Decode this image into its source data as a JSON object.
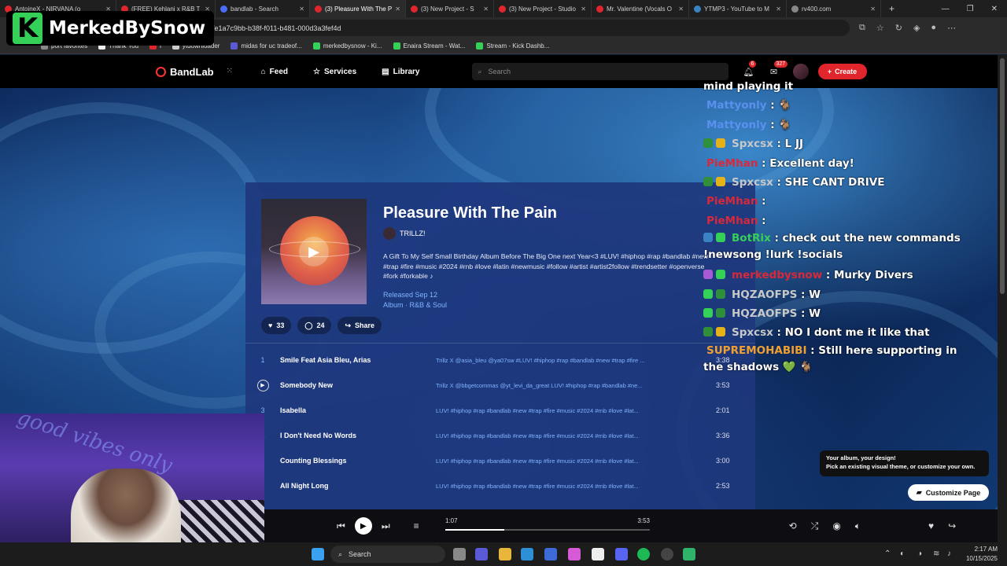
{
  "browser": {
    "tabs": [
      {
        "title": "AntoineX - NIRVANA (o",
        "color": "#e0262c"
      },
      {
        "title": "(FREE) Kehlani x R&B T",
        "color": "#e0262c"
      },
      {
        "title": "bandlab - Search",
        "color": "#4a6cf7"
      },
      {
        "title": "(3) Pleasure With The P",
        "color": "#e0262c"
      },
      {
        "title": "(3) New Project - S",
        "color": "#e0262c"
      },
      {
        "title": "(3) New Project - Studio",
        "color": "#e0262c"
      },
      {
        "title": "Mr. Valentine (Vocals O",
        "color": "#e0262c"
      },
      {
        "title": "YTMP3 - YouTube to M",
        "color": "#3b82c4"
      },
      {
        "title": "rv400.com",
        "color": "#888888"
      }
    ],
    "url": "/e1a7c9bb-b38f-f011-b481-000d3a3fef4d",
    "bookmarks": [
      "port favorites",
      "Thank You",
      "i",
      "ytdownloader",
      "midas for uc tradeof...",
      "merkedbysnow - Ki...",
      "Enaira Stream - Wat...",
      "Stream - Kick Dashb..."
    ]
  },
  "overlay_logo": {
    "letter": "K",
    "name": "MerkedBySnow",
    "accent": "#34d058"
  },
  "bandlab": {
    "brand": "BandLab",
    "nav": {
      "feed": "Feed",
      "services": "Services",
      "library": "Library"
    },
    "search_placeholder": "Search",
    "notif_badge": "6",
    "msg_badge": "327",
    "create_label": "Create"
  },
  "album": {
    "title": "Pleasure With The Pain",
    "artist": "TRILLZ!",
    "description": "A Gift To My Self Small Birthday Album Before The Big One next Year<3 #LUV! #hiphop #rap #bandlab #new #trap #fire #music #2024 #rnb #love #latin #newmusic #follow #artist #artist2follow #trendsetter #openverse #fork #forkable ♪",
    "released": "Released Sep 12",
    "type_genre": "Album · R&B & Soul",
    "likes": "33",
    "comments": "24",
    "share_label": "Share"
  },
  "tracks": [
    {
      "num": "1",
      "name": "Smile Feat Asia Bleu, Arias",
      "tags": "Trillz X @asia_bleu @ya07sw #LUV! #hiphop #rap #bandlab #new #trap #fire ...",
      "dur": "3:38"
    },
    {
      "num": "",
      "name": "Somebody New",
      "tags": "Trillz X @bbgetcommas @yt_levi_da_great LUV! #hiphop #rap #bandlab #ne...",
      "dur": "3:53"
    },
    {
      "num": "3",
      "name": "Isabella",
      "tags": "LUV! #hiphop #rap #bandlab #new #trap #fire #music #2024 #rnb #love #lat...",
      "dur": "2:01"
    },
    {
      "num": "4",
      "name": "I Don't Need No Words",
      "tags": "LUV! #hiphop #rap #bandlab #new #trap #fire #music #2024 #rnb #love #lat...",
      "dur": "3:36"
    },
    {
      "num": "5",
      "name": "Counting Blessings",
      "tags": "LUV! #hiphop #rap #bandlab #new #trap #fire #music #2024 #rnb #love #lat...",
      "dur": "3:00"
    },
    {
      "num": "6",
      "name": "All Night Long",
      "tags": "LUV! #hiphop #rap #bandlab #new #trap #fire #music #2024 #rnb #love #lat...",
      "dur": "2:53"
    }
  ],
  "chat": [
    {
      "user": "",
      "text": "mind playing it",
      "color": "#ffffff",
      "icons": []
    },
    {
      "user": "Mattyonly",
      "text": ": 🐐",
      "color": "#5b8ff0",
      "icons": []
    },
    {
      "user": "Mattyonly",
      "text": ": 🐐",
      "color": "#5b8ff0",
      "icons": []
    },
    {
      "user": "Spxcsx",
      "text": ": L JJ",
      "color": "#c8c8c8",
      "icons": [
        "#2f8f3a",
        "#e6b21a"
      ]
    },
    {
      "user": "PieMhan",
      "text": ": Excellent day!",
      "color": "#d9283a",
      "icons": []
    },
    {
      "user": "Spxcsx",
      "text": ": SHE CANT DRIVE",
      "color": "#c8c8c8",
      "icons": [
        "#2f8f3a",
        "#e6b21a"
      ]
    },
    {
      "user": "PieMhan",
      "text": ":",
      "color": "#d9283a",
      "icons": []
    },
    {
      "user": "PieMhan",
      "text": ":",
      "color": "#d9283a",
      "icons": []
    },
    {
      "user": "BotRix",
      "text": ": check out the new commands !newsong !lurk !socials",
      "color": "#34d058",
      "icons": [
        "#3b82c4",
        "#34d058"
      ]
    },
    {
      "user": "merkedbysnow",
      "text": ": Murky Divers",
      "color": "#d9283a",
      "icons": [
        "#a85ad6",
        "#34d058"
      ]
    },
    {
      "user": "HQZAOFPS",
      "text": ": W",
      "color": "#c8c8c8",
      "icons": [
        "#34d058",
        "#2f8f3a"
      ]
    },
    {
      "user": "HQZAOFPS",
      "text": ": W",
      "color": "#c8c8c8",
      "icons": [
        "#34d058",
        "#2f8f3a"
      ]
    },
    {
      "user": "Spxcsx",
      "text": ": NO I dont me it like that",
      "color": "#c8c8c8",
      "icons": [
        "#2f8f3a",
        "#e6b21a"
      ]
    },
    {
      "user": "SUPREMOHABIBI",
      "text": ": Still here supporting in the shadows 💚 🐐",
      "color": "#f0a030",
      "icons": []
    }
  ],
  "customize": {
    "tooltip_line1": "Your album, your design!",
    "tooltip_line2": "Pick an existing visual theme, or customize your own.",
    "button": "Customize Page"
  },
  "player": {
    "elapsed": "1:07",
    "total": "3:53",
    "progress": 0.29
  },
  "webcam": {
    "neon_text": "good vibes only"
  },
  "taskbar": {
    "search_placeholder": "Search",
    "time": "2:17 AM",
    "date": "10/15/2025"
  }
}
